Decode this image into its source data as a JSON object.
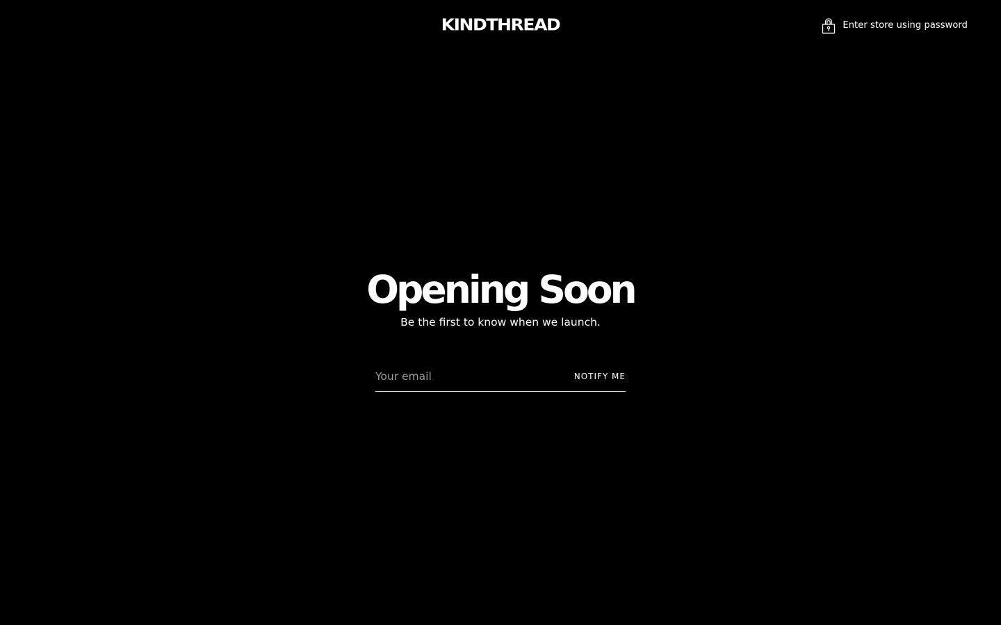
{
  "header": {
    "logo_text": "KINDTHREAD",
    "password_link": {
      "icon": "lock-icon",
      "label": "Enter store using password"
    }
  },
  "hero": {
    "title": "Opening Soon",
    "subtitle": "Be the first to know when we launch."
  },
  "signup": {
    "email_placeholder": "Your email",
    "email_value": "",
    "button_label": "NOTIFY ME"
  },
  "colors": {
    "background": "#000000",
    "text": "#ffffff",
    "placeholder": "#9a9a9a"
  }
}
